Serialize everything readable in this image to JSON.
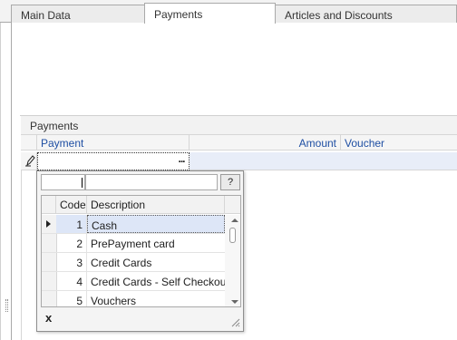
{
  "tabs": [
    {
      "label": "Main Data"
    },
    {
      "label": "Payments"
    },
    {
      "label": "Articles and Discounts"
    }
  ],
  "group": {
    "title": "Payments"
  },
  "grid": {
    "columns": [
      "Payment",
      "Amount",
      "Voucher"
    ],
    "edit_row": {
      "payment": "",
      "amount": "",
      "voucher": ""
    },
    "ellipsis_label": "..."
  },
  "lookup": {
    "code_filter": "",
    "description_filter": "",
    "help_label": "?",
    "columns": [
      "Code",
      "Description"
    ],
    "rows": [
      {
        "code": "1",
        "description": "Cash"
      },
      {
        "code": "2",
        "description": "PrePayment card"
      },
      {
        "code": "3",
        "description": "Credit Cards"
      },
      {
        "code": "4",
        "description": "Credit Cards - Self Checkout"
      },
      {
        "code": "5",
        "description": "Vouchers"
      }
    ],
    "close_label": "x"
  }
}
